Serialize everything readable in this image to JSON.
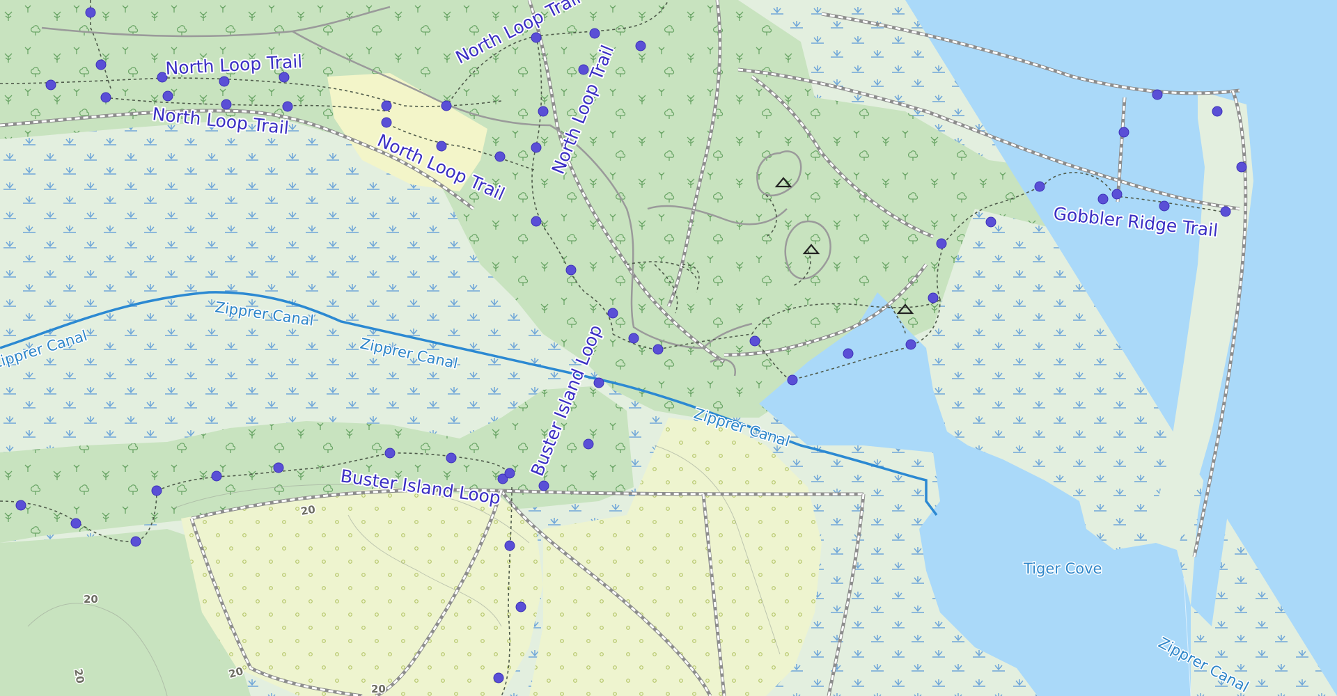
{
  "map": {
    "trail_labels": [
      "North Loop Trail",
      "North Loop Trail",
      "North Loop Trail",
      "North Loop Trail",
      "North Loop Trail",
      "Buster Island Loop",
      "Buster Island Loop",
      "Gobbler Ridge Trail"
    ],
    "water_labels": [
      "Zipprer Canal",
      "Zipprer Canal",
      "Zipprer Canal",
      "Zipprer Canal",
      "Zipprer Canal",
      "Tiger Cove"
    ],
    "contour_labels": [
      "20",
      "20",
      "20",
      "20",
      "20"
    ],
    "colors": {
      "water": "#aad9f9",
      "marsh_land": "#e3efdf",
      "forest": "#c8e3bf",
      "scrub": "#eef4cf",
      "trail_marker": "#5a4fd6",
      "canal": "#2c89d2",
      "label_text": "#3b2fc4"
    },
    "icons": {
      "trail_marker": "dot-marker-icon",
      "campsite": "campsite-triangle-icon",
      "marsh": "marsh-symbol-icon",
      "tree": "tree-symbol-icon"
    }
  }
}
